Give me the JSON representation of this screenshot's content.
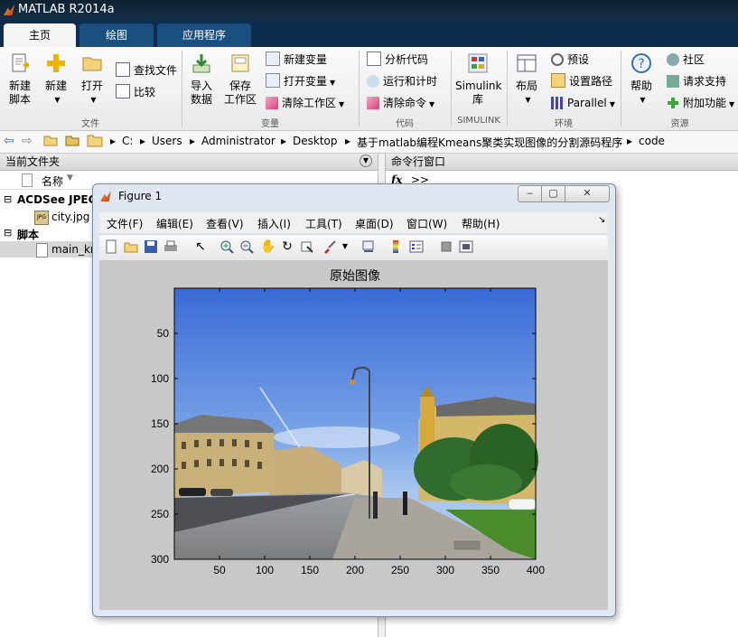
{
  "window": {
    "title": "MATLAB R2014a"
  },
  "tabs": [
    {
      "label": "主页"
    },
    {
      "label": "绘图"
    },
    {
      "label": "应用程序"
    }
  ],
  "ribbon": {
    "file": {
      "new_script": "新建\n脚本",
      "new": "新建",
      "open": "打开",
      "find_files": "查找文件",
      "compare": "比较",
      "section": "文件"
    },
    "variable": {
      "import": "导入\n数据",
      "save": "保存\n工作区",
      "new_var": "新建变量",
      "open_var": "打开变量",
      "clear_ws": "清除工作区",
      "section": "变量"
    },
    "code": {
      "analyze": "分析代码",
      "run_time": "运行和计时",
      "clear_cmd": "清除命令",
      "section": "代码"
    },
    "simulink": {
      "label": "Simulink\n库",
      "section": "SIMULINK"
    },
    "env": {
      "layout": "布局",
      "prefs": "预设",
      "set_path": "设置路径",
      "parallel": "Parallel",
      "section": "环境"
    },
    "resources": {
      "help": "帮助",
      "community": "社区",
      "support": "请求支持",
      "addons": "附加功能",
      "section": "资源"
    }
  },
  "address": {
    "parts": [
      "C:",
      "Users",
      "Administrator",
      "Desktop",
      "基于matlab编程Kmeans聚类实现图像的分割源码程序",
      "code"
    ]
  },
  "left_panel": {
    "title": "当前文件夹",
    "col_name": "名称",
    "group1": "ACDSee JPEG",
    "file1": "city.jpg",
    "group2": "脚本",
    "file2": "main_kmeans.m"
  },
  "right_panel": {
    "title": "命令行窗口",
    "prompt": ">>"
  },
  "figure": {
    "title": "Figure 1",
    "menu": [
      "文件(F)",
      "编辑(E)",
      "查看(V)",
      "插入(I)",
      "工具(T)",
      "桌面(D)",
      "窗口(W)",
      "帮助(H)"
    ],
    "axes_title": "原始图像",
    "xticks": [
      "50",
      "100",
      "150",
      "200",
      "250",
      "300",
      "350",
      "400"
    ],
    "yticks": [
      "50",
      "100",
      "150",
      "200",
      "250",
      "300"
    ]
  }
}
